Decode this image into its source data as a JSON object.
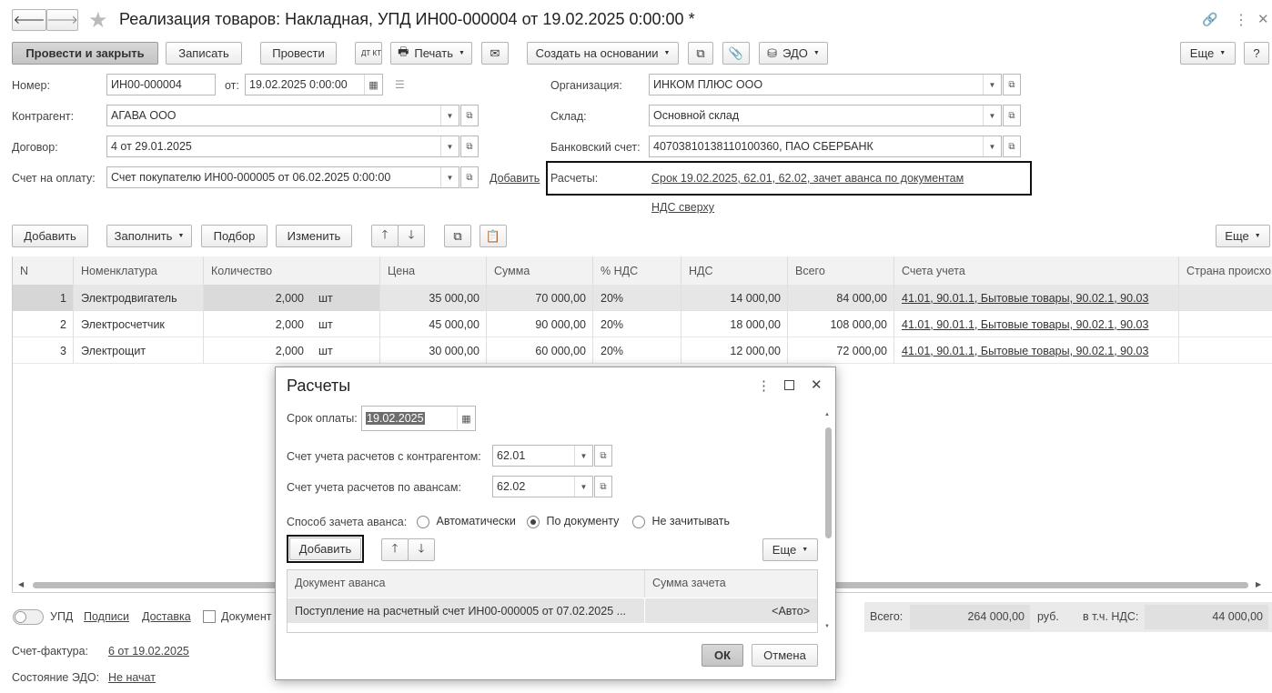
{
  "window": {
    "title": "Реализация товаров: Накладная, УПД ИН00-000004 от 19.02.2025 0:00:00 *"
  },
  "toolbar": {
    "post_close": "Провести и закрыть",
    "save": "Записать",
    "post": "Провести",
    "dt_kt": "ДТ КТ",
    "print": "Печать",
    "create_based": "Создать на основании",
    "edo": "ЭДО",
    "more": "Еще",
    "help": "?"
  },
  "header": {
    "number_label": "Номер:",
    "number": "ИН00-000004",
    "date_label": "от:",
    "date": "19.02.2025  0:00:00",
    "contractor_label": "Контрагент:",
    "contractor": "АГАВА  ООО",
    "contract_label": "Договор:",
    "contract": "4 от 29.01.2025",
    "invoice_label": "Счет на оплату:",
    "invoice": "Счет покупателю ИН00-000005 от 06.02.2025 0:00:00",
    "add": "Добавить",
    "org_label": "Организация:",
    "org": "ИНКОМ ПЛЮС ООО",
    "warehouse_label": "Склад:",
    "warehouse": "Основной склад",
    "bank_label": "Банковский счет:",
    "bank": "40703810138110100360, ПАО СБЕРБАНК",
    "settlements_label": "Расчеты:",
    "settlements": "Срок 19.02.2025, 62.01, 62.02, зачет аванса по документам",
    "vat_top": "НДС сверху"
  },
  "table_toolbar": {
    "add": "Добавить",
    "fill": "Заполнить",
    "select": "Подбор",
    "change": "Изменить",
    "more": "Еще"
  },
  "table": {
    "columns": [
      "N",
      "Номенклатура",
      "Количество",
      "Цена",
      "Сумма",
      "% НДС",
      "НДС",
      "Всего",
      "Счета учета",
      "Страна происхо"
    ],
    "rows": [
      {
        "n": "1",
        "item": "Электродвигатель",
        "qty": "2,000",
        "unit": "шт",
        "price": "35 000,00",
        "sum": "70 000,00",
        "vat_rate": "20%",
        "vat": "14 000,00",
        "total": "84 000,00",
        "accounts": "41.01, 90.01.1, Бытовые товары, 90.02.1, 90.03"
      },
      {
        "n": "2",
        "item": "Электросчетчик",
        "qty": "2,000",
        "unit": "шт",
        "price": "45 000,00",
        "sum": "90 000,00",
        "vat_rate": "20%",
        "vat": "18 000,00",
        "total": "108 000,00",
        "accounts": "41.01, 90.01.1, Бытовые товары, 90.02.1, 90.03"
      },
      {
        "n": "3",
        "item": "Электрощит",
        "qty": "2,000",
        "unit": "шт",
        "price": "30 000,00",
        "sum": "60 000,00",
        "vat_rate": "20%",
        "vat": "12 000,00",
        "total": "72 000,00",
        "accounts": "41.01, 90.01.1, Бытовые товары, 90.02.1, 90.03"
      }
    ]
  },
  "footer": {
    "upd": "УПД",
    "signatures": "Подписи",
    "delivery": "Доставка",
    "document": "Документ",
    "total_label": "Всего:",
    "total": "264 000,00",
    "currency": "руб.",
    "vat_label": "в т.ч. НДС:",
    "vat": "44 000,00",
    "invoice_label": "Счет-фактура:",
    "invoice": "6 от 19.02.2025",
    "edo_label": "Состояние ЭДО:",
    "edo": "Не начат"
  },
  "dialog": {
    "title": "Расчеты",
    "due_label": "Срок оплаты:",
    "due": "19.02.2025",
    "acc_contractor_label": "Счет учета расчетов с контрагентом:",
    "acc_contractor": "62.01",
    "acc_advance_label": "Счет учета расчетов по авансам:",
    "acc_advance": "62.02",
    "method_label": "Способ зачета аванса:",
    "opt_auto": "Автоматически",
    "opt_doc": "По документу",
    "opt_none": "Не зачитывать",
    "add": "Добавить",
    "more": "Еще",
    "col_doc": "Документ аванса",
    "col_sum": "Сумма зачета",
    "row_doc": "Поступление на расчетный счет ИН00-000005 от 07.02.2025 ...",
    "row_sum": "<Авто>",
    "ok": "ОК",
    "cancel": "Отмена"
  }
}
